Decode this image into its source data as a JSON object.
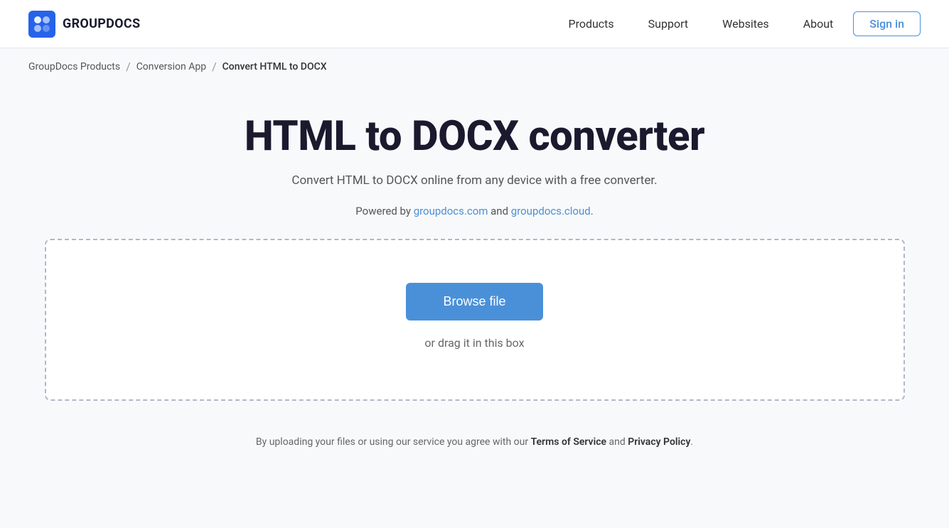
{
  "header": {
    "logo_text": "GROUPDOCS",
    "nav": {
      "products": "Products",
      "support": "Support",
      "websites": "Websites",
      "about": "About",
      "sign_in": "Sign in"
    }
  },
  "breadcrumb": {
    "home": "GroupDocs Products",
    "conversion_app": "Conversion App",
    "current": "Convert HTML to DOCX"
  },
  "main": {
    "title": "HTML to DOCX converter",
    "subtitle": "Convert HTML to DOCX online from any device with a free converter.",
    "powered_by_prefix": "Powered by ",
    "powered_by_link1": "groupdocs.com",
    "powered_by_link1_url": "#",
    "powered_by_and": " and ",
    "powered_by_link2": "groupdocs.cloud",
    "powered_by_link2_url": "#",
    "powered_by_suffix": ".",
    "browse_btn": "Browse file",
    "drag_text": "or drag it in this box"
  },
  "footer": {
    "note_prefix": "By uploading your files or using our service you agree with our ",
    "terms_link": "Terms of Service",
    "note_and": " and ",
    "privacy_link": "Privacy Policy",
    "note_suffix": "."
  }
}
